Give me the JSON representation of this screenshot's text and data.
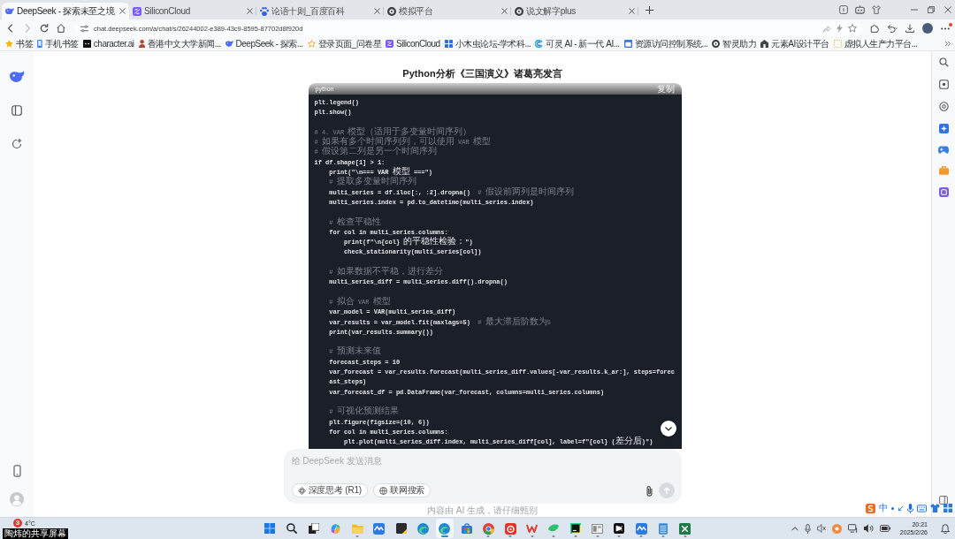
{
  "browser": {
    "tabs": [
      {
        "title": "DeepSeek - 探索未至之境",
        "kind": "whale",
        "selected": true
      },
      {
        "title": "SiliconCloud",
        "kind": "tile",
        "selected": false
      },
      {
        "title": "论语十则_百度百科",
        "kind": "paw",
        "selected": false
      },
      {
        "title": "模拟平台",
        "kind": "ring",
        "selected": false
      },
      {
        "title": "说文解字plus",
        "kind": "ring",
        "selected": false
      }
    ],
    "url": "chat.deepseek.com/a/chat/s/26244002-e389-43c9-8595-87702d8f920d",
    "menu_badge": true,
    "bookmarks": [
      {
        "label": "书签",
        "kind": "star"
      },
      {
        "label": "手机书签",
        "kind": "phone"
      },
      {
        "label": "character.ai",
        "kind": "square"
      },
      {
        "label": "香港中文大学新闻...",
        "kind": "person"
      },
      {
        "label": "DeepSeek - 探索...",
        "kind": "whale"
      },
      {
        "label": "登录页面_问卷星",
        "kind": "outline"
      },
      {
        "label": "SiliconCloud",
        "kind": "tile"
      },
      {
        "label": "小木虫论坛-学术科...",
        "kind": "grid"
      },
      {
        "label": "可灵 AI - 新一代 AI...",
        "kind": "swirl"
      },
      {
        "label": "资源访问控制系统...",
        "kind": "window"
      },
      {
        "label": "智灵助力",
        "kind": "ring"
      },
      {
        "label": "元素AI设计平台",
        "kind": "building"
      },
      {
        "label": "虚拟人生产力平台...",
        "kind": "dashed"
      }
    ]
  },
  "chat": {
    "title": "Python分析《三国演义》诸葛亮发言",
    "code_block": {
      "language": "python",
      "copy_label": "复制",
      "lines": [
        {
          "kind": "code",
          "text": "plt.legend()"
        },
        {
          "kind": "code",
          "text": "plt.show()"
        },
        {
          "kind": "blank"
        },
        {
          "kind": "comment",
          "text": "# 4. VAR 模型（适用于多变量时间序列）"
        },
        {
          "kind": "comment",
          "text": "# 如果有多个时间序列列，可以使用 VAR 模型"
        },
        {
          "kind": "comment",
          "text": "# 假设第二列是另一个时间序列"
        },
        {
          "kind": "code",
          "text": "if df.shape[1] > 1:",
          "children": [
            {
              "kind": "code",
              "text": "print(\"\\n=== VAR 模型 ===\")"
            },
            {
              "kind": "comment",
              "text": "# 提取多变量时间序列"
            },
            {
              "kind": "code",
              "text": "multi_series = df.iloc[:, :2].dropna()",
              "comment": "# 假设前两列是时间序列"
            },
            {
              "kind": "code",
              "text": "multi_series.index = pd.to_datetime(multi_series.index)"
            },
            {
              "kind": "blank"
            },
            {
              "kind": "comment",
              "text": "# 检查平稳性"
            },
            {
              "kind": "code",
              "text": "for col in multi_series.columns:",
              "children": [
                {
                  "kind": "code",
                  "text": "print(f\"\\n{col} 的平稳性检验：\")"
                },
                {
                  "kind": "code",
                  "text": "check_stationarity(multi_series[col])"
                }
              ]
            },
            {
              "kind": "blank"
            },
            {
              "kind": "comment",
              "text": "# 如果数据不平稳，进行差分"
            },
            {
              "kind": "code",
              "text": "multi_series_diff = multi_series.diff().dropna()"
            },
            {
              "kind": "blank"
            },
            {
              "kind": "comment",
              "text": "# 拟合 VAR 模型"
            },
            {
              "kind": "code",
              "text": "var_model = VAR(multi_series_diff)"
            },
            {
              "kind": "code",
              "text": "var_results = var_model.fit(maxlags=5)",
              "comment": "# 最大滞后阶数为5"
            },
            {
              "kind": "code",
              "text": "print(var_results.summary())"
            },
            {
              "kind": "blank"
            },
            {
              "kind": "comment",
              "text": "# 预测未来值"
            },
            {
              "kind": "code",
              "text": "forecast_steps = 10"
            },
            {
              "kind": "code",
              "text": "var_forecast = var_results.forecast(multi_series_diff.values[-var_results.k_ar:], steps=forecast_steps)"
            },
            {
              "kind": "code",
              "text": "var_forecast_df = pd.DataFrame(var_forecast, columns=multi_series.columns)"
            },
            {
              "kind": "blank"
            },
            {
              "kind": "comment",
              "text": "# 可视化预测结果"
            },
            {
              "kind": "code",
              "text": "plt.figure(figsize=(10, 6))"
            },
            {
              "kind": "code",
              "text": "for col in multi_series.columns:",
              "children": [
                {
                  "kind": "code",
                  "text": "plt.plot(multi_series_diff.index, multi_series_diff[col], label=f\"{col} (差分后)\")"
                }
              ]
            }
          ]
        }
      ]
    },
    "composer": {
      "placeholder": "给 DeepSeek 发送消息",
      "toggles": [
        {
          "label": "深度思考 (R1)",
          "kind": "atom",
          "on": false
        },
        {
          "label": "联网搜索",
          "kind": "globe",
          "on": false
        }
      ],
      "send_disabled": true
    },
    "footer": "内容由 AI 生成，请仔细甄别"
  },
  "ime": {
    "mode": "中"
  },
  "taskbar": {
    "weather": {
      "badge": "3",
      "temperature": "4°C"
    },
    "share_label": "陶炜的共享屏幕",
    "apps": [
      {
        "kind": "grid",
        "running": false,
        "active": false
      },
      {
        "kind": "search",
        "running": false,
        "active": false
      },
      {
        "kind": "stack",
        "running": false,
        "active": false
      },
      {
        "kind": "swirl",
        "running": false,
        "active": false
      },
      {
        "kind": "folder",
        "running": true,
        "active": false
      },
      {
        "kind": "wave",
        "running": false,
        "active": false
      },
      {
        "kind": "note",
        "running": false,
        "active": false
      },
      {
        "kind": "circle",
        "running": false,
        "active": false
      },
      {
        "kind": "circle",
        "running": true,
        "active": true
      },
      {
        "kind": "bag",
        "running": false,
        "active": false
      },
      {
        "kind": "ring",
        "running": true,
        "active": false
      },
      {
        "kind": "disc",
        "running": true,
        "active": false
      },
      {
        "kind": "zigzag",
        "running": true,
        "active": false
      },
      {
        "kind": "leaf",
        "running": true,
        "active": false
      },
      {
        "kind": "code",
        "running": true,
        "active": false
      },
      {
        "kind": "window",
        "running": true,
        "active": false
      },
      {
        "kind": "cut",
        "running": true,
        "active": false
      },
      {
        "kind": "wave",
        "running": true,
        "active": false
      },
      {
        "kind": "notepad",
        "running": true,
        "active": false
      },
      {
        "kind": "sheet",
        "running": true,
        "active": false
      }
    ],
    "time": "20:21",
    "date": "2025/2/26"
  }
}
